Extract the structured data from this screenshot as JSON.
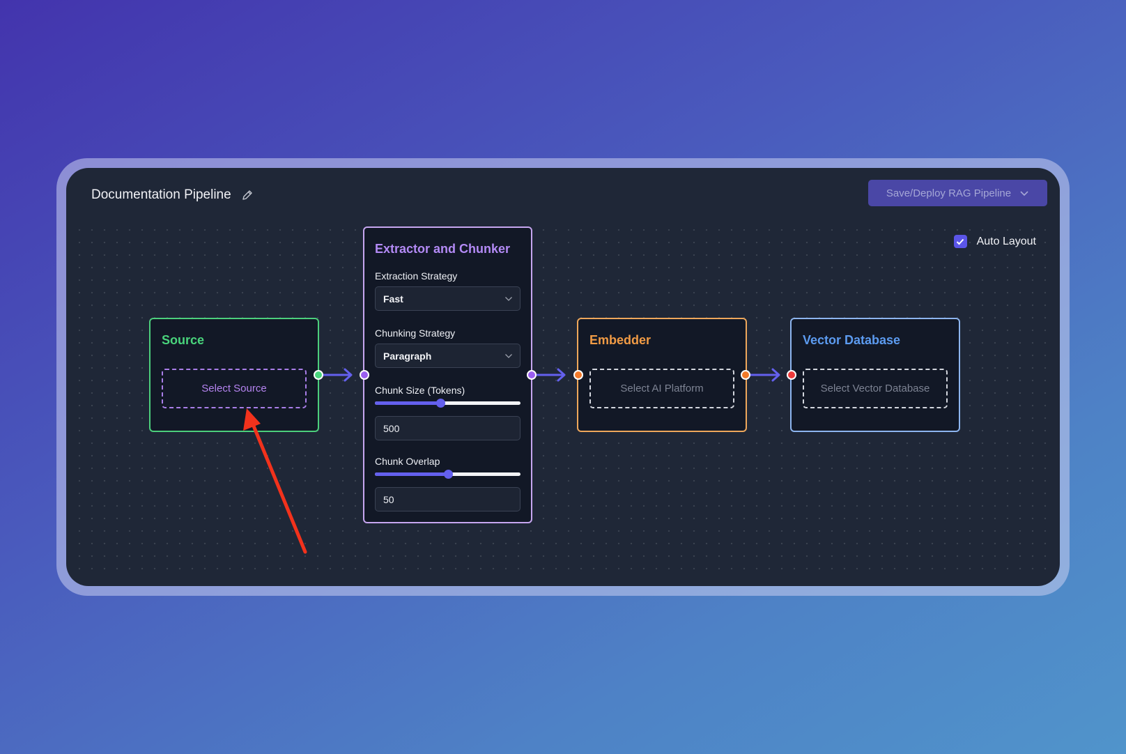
{
  "pipeline": {
    "title": "Documentation Pipeline",
    "deploy_label": "Save/Deploy RAG Pipeline",
    "auto_layout_label": "Auto Layout",
    "auto_layout_checked": true
  },
  "nodes": {
    "source": {
      "title": "Source",
      "select_label": "Select Source"
    },
    "extractor": {
      "title": "Extractor and Chunker",
      "extraction_label": "Extraction Strategy",
      "extraction_value": "Fast",
      "chunking_label": "Chunking Strategy",
      "chunking_value": "Paragraph",
      "chunk_size_label": "Chunk Size (Tokens)",
      "chunk_size_value": "500",
      "chunk_size_slider_fraction": 0.45,
      "chunk_overlap_label": "Chunk Overlap",
      "chunk_overlap_value": "50",
      "chunk_overlap_slider_fraction": 0.5
    },
    "embedder": {
      "title": "Embedder",
      "select_label": "Select AI Platform"
    },
    "vector_db": {
      "title": "Vector Database",
      "select_label": "Select Vector Database"
    }
  },
  "colors": {
    "source": "#49d47c",
    "extractor": "#b38af5",
    "embedder": "#f19b45",
    "vector_db": "#5c9bf0",
    "edge": "#6460ee",
    "annotation_arrow": "#f2321c"
  },
  "icons": [
    "pencil-icon",
    "chevron-down-icon",
    "checkmark-icon",
    "arrow-right-icon"
  ]
}
